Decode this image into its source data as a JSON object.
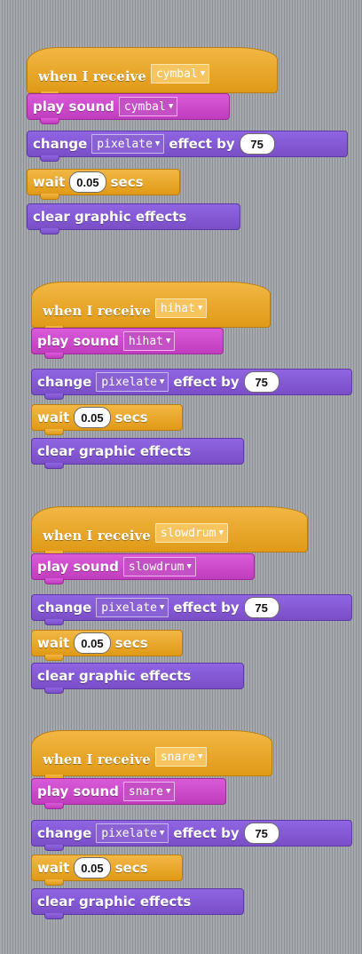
{
  "scripts": [
    {
      "message": "cymbal",
      "when_receive_label": "when I receive",
      "play_sound_label": "play sound",
      "sound": "cymbal",
      "change_label": "change",
      "effect": "pixelate",
      "effect_by_label": "effect by",
      "amount": "75",
      "wait_label": "wait",
      "wait_value": "0.05",
      "secs_label": "secs",
      "clear_label": "clear graphic effects"
    },
    {
      "message": "hihat",
      "when_receive_label": "when I receive",
      "play_sound_label": "play sound",
      "sound": "hihat",
      "change_label": "change",
      "effect": "pixelate",
      "effect_by_label": "effect by",
      "amount": "75",
      "wait_label": "wait",
      "wait_value": "0.05",
      "secs_label": "secs",
      "clear_label": "clear graphic effects"
    },
    {
      "message": "slowdrum",
      "when_receive_label": "when I receive",
      "play_sound_label": "play sound",
      "sound": "slowdrum",
      "change_label": "change",
      "effect": "pixelate",
      "effect_by_label": "effect by",
      "amount": "75",
      "wait_label": "wait",
      "wait_value": "0.05",
      "secs_label": "secs",
      "clear_label": "clear graphic effects"
    },
    {
      "message": "snare",
      "when_receive_label": "when I receive",
      "play_sound_label": "play sound",
      "sound": "snare",
      "change_label": "change",
      "effect": "pixelate",
      "effect_by_label": "effect by",
      "amount": "75",
      "wait_label": "wait",
      "wait_value": "0.05",
      "secs_label": "secs",
      "clear_label": "clear graphic effects"
    }
  ],
  "colors": {
    "events": "#e6a522",
    "sound": "#cc4fcb",
    "looks": "#8556d6",
    "control": "#e6a522",
    "scripts_area": "#9a9da2"
  },
  "icons": {
    "dropdown": "dropdown-triangle-icon"
  }
}
